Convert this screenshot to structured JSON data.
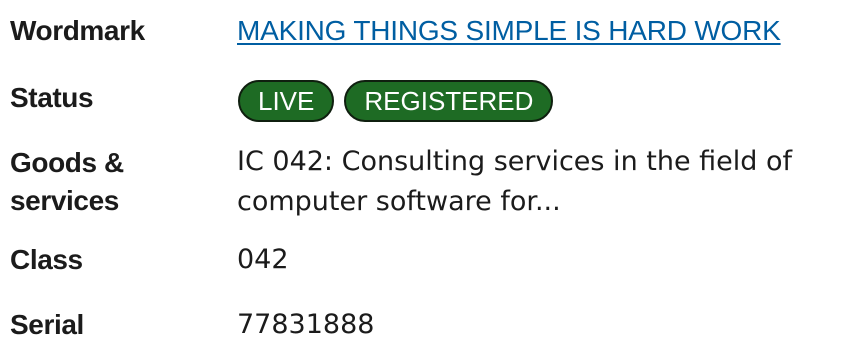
{
  "record": {
    "wordmark": {
      "label": "Wordmark",
      "value": "MAKING THINGS SIMPLE IS HARD WORK"
    },
    "status": {
      "label": "Status",
      "badges": [
        "LIVE",
        "REGISTERED"
      ],
      "badge_color": "#1e6b24"
    },
    "goods_services": {
      "label_line1": "Goods &",
      "label_line2": "services",
      "value": "IC 042: Consulting services in the field of computer software for..."
    },
    "class": {
      "label": "Class",
      "value": "042"
    },
    "serial": {
      "label": "Serial",
      "value": "77831888"
    }
  },
  "colors": {
    "link": "#005ea2",
    "text": "#1b1b1b",
    "badge_bg": "#1e6b24"
  }
}
